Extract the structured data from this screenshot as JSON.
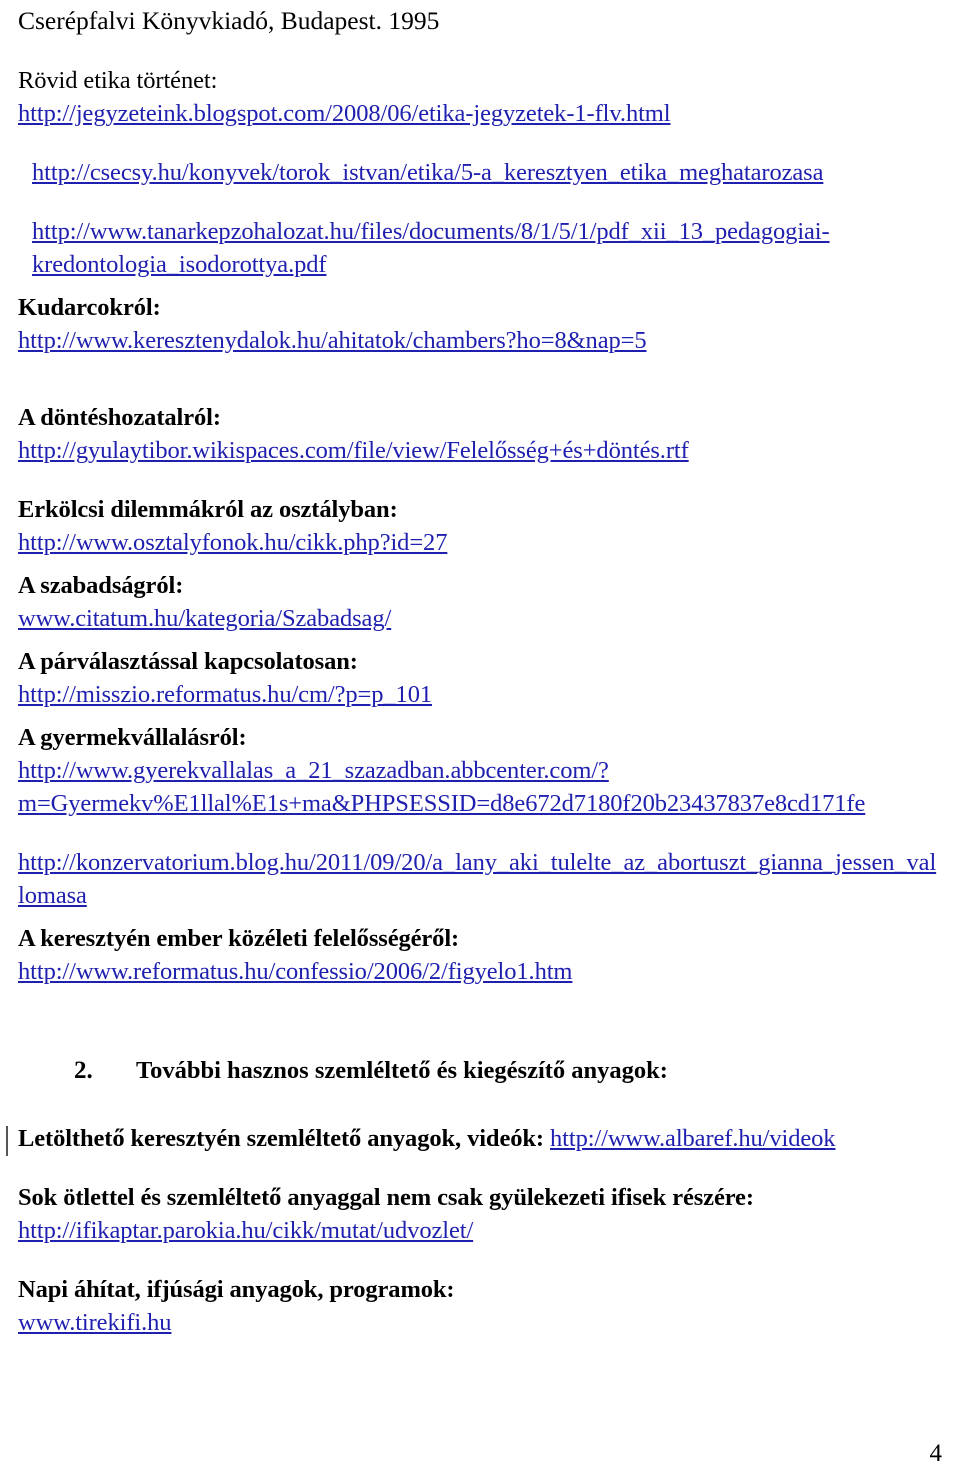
{
  "document": {
    "page_number": "4",
    "link_color": "#2020b0",
    "text_color": "#000000",
    "background_color": "#ffffff",
    "blocks": [
      {
        "type": "plain",
        "text": "Cserépfalvi Könyvkiadó, Budapest. 1995"
      },
      {
        "type": "plain",
        "text": "Rövid etika történet:"
      },
      {
        "type": "link",
        "text": "http://jegyzeteink.blogspot.com/2008/06/etika-jegyzetek-1-flv.html"
      },
      {
        "type": "link",
        "text": "http://csecsy.hu/konyvek/torok_istvan/etika/5-a_keresztyen_etika_meghatarozasa"
      },
      {
        "type": "link",
        "text": "http://www.tanarkepzohalozat.hu/files/documents/8/1/5/1/pdf_xii_13_pedagogiai-kredontologia_isodorottya.pdf"
      },
      {
        "type": "heading",
        "text": "Kudarcokról:"
      },
      {
        "type": "link",
        "text": "http://www.keresztenydalok.hu/ahitatok/chambers?ho=8&nap=5"
      },
      {
        "type": "heading",
        "text": "A döntéshozatalról:"
      },
      {
        "type": "link",
        "text": "http://gyulaytibor.wikispaces.com/file/view/Felelősség+és+döntés.rtf"
      },
      {
        "type": "heading",
        "text": "Erkölcsi dilemmákról az osztályban:"
      },
      {
        "type": "link",
        "text": "http://www.osztalyfonok.hu/cikk.php?id=27"
      },
      {
        "type": "heading",
        "text": "A szabadságról:"
      },
      {
        "type": "link",
        "text": "www.citatum.hu/kategoria/Szabadsag/"
      },
      {
        "type": "heading",
        "text": "A párválasztással kapcsolatosan:"
      },
      {
        "type": "link",
        "text": "http://misszio.reformatus.hu/cm/?p=p_101"
      },
      {
        "type": "heading",
        "text": "A gyermekvállalásról:"
      },
      {
        "type": "link",
        "text": "http://www.gyerekvallalas_a_21_szazadban.abbcenter.com/?m=Gyermekv%E1llal%E1s+ma&PHPSESSID=d8e672d7180f20b23437837e8cd171fe"
      },
      {
        "type": "link",
        "text": "http://konzervatorium.blog.hu/2011/09/20/a_lany_aki_tulelte_az_abortuszt_gianna_jessen_vallomasa"
      },
      {
        "type": "heading",
        "text": "A keresztyén ember közéleti felelősségéről:"
      },
      {
        "type": "link",
        "text": "http://www.reformatus.hu/confessio/2006/2/figyelo1.htm"
      }
    ],
    "section": {
      "number": "2.",
      "title": "További hasznos szemléltető és kiegészítő anyagok:"
    },
    "tail": {
      "item1_label": "Letölthető keresztyén szemléltető anyagok, videók:",
      "item1_link": "http://www.albaref.hu/videok",
      "item2_label": "Sok ötlettel és szemléltető anyaggal nem csak gyülekezeti ifisek részére:",
      "item2_link": "http://ifikaptar.parokia.hu/cikk/mutat/udvozlet/",
      "item3_label": "Napi áhítat, ifjúsági anyagok, programok:",
      "item3_link": "www.tirekifi.hu"
    }
  }
}
